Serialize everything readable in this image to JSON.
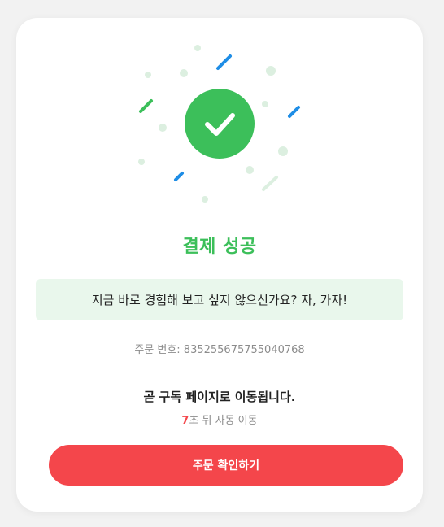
{
  "colors": {
    "success_green": "#3cbf5a",
    "confetti_blue": "#1e8de6",
    "confetti_light": "#dcefe0",
    "message_bg": "#e9f7ec",
    "button_red": "#f4464b",
    "countdown_red": "#f4464b"
  },
  "icons": {
    "success": "check-circle-icon"
  },
  "status": {
    "title": "결제 성공"
  },
  "message": {
    "text": "지금 바로 경험해 보고 싶지 않으신가요? 자, 가자!"
  },
  "order": {
    "label": "주문 번호: 835255675755040768"
  },
  "redirect": {
    "text": "곧 구독 페이지로 이동됩니다.",
    "seconds": "7",
    "suffix": "초 뒤 자동 이동"
  },
  "button": {
    "label": "주문 확인하기"
  }
}
